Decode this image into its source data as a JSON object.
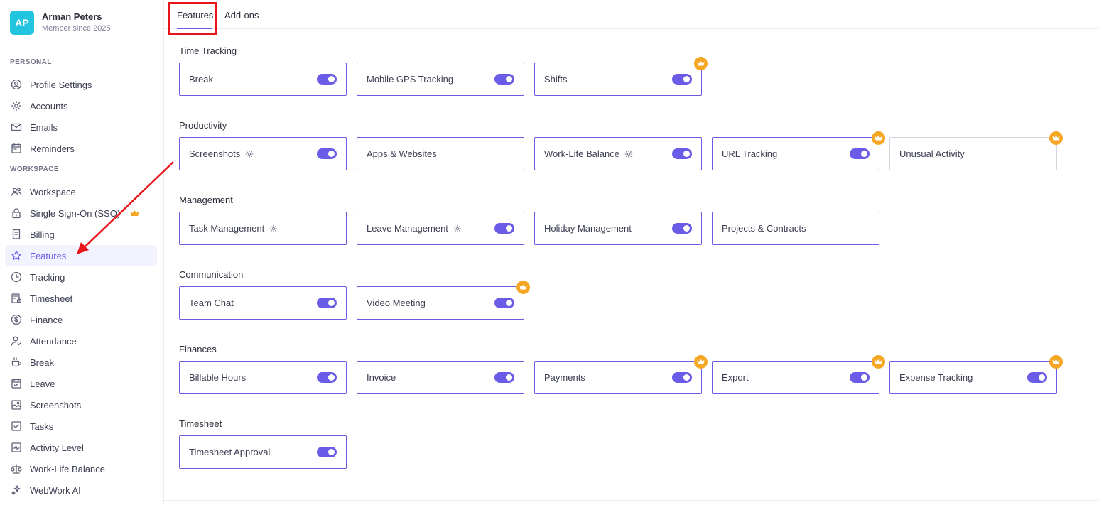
{
  "profile": {
    "initials": "AP",
    "name": "Arman Peters",
    "subtitle": "Member since 2025"
  },
  "sidebar": {
    "personal_label": "PERSONAL",
    "workspace_label": "WORKSPACE",
    "personal_items": [
      {
        "label": "Profile Settings",
        "icon": "user-circle-icon"
      },
      {
        "label": "Accounts",
        "icon": "gear-icon"
      },
      {
        "label": "Emails",
        "icon": "mail-icon"
      },
      {
        "label": "Reminders",
        "icon": "calendar-icon"
      }
    ],
    "workspace_items": [
      {
        "label": "Workspace",
        "icon": "users-icon"
      },
      {
        "label": "Single Sign-On (SSO)",
        "icon": "lock-icon"
      },
      {
        "label": "Billing",
        "icon": "receipt-icon"
      },
      {
        "label": "Features",
        "icon": "star-icon"
      },
      {
        "label": "Tracking",
        "icon": "clock-icon"
      },
      {
        "label": "Timesheet",
        "icon": "timesheet-icon"
      },
      {
        "label": "Finance",
        "icon": "dollar-icon"
      },
      {
        "label": "Attendance",
        "icon": "user-check-icon"
      },
      {
        "label": "Break",
        "icon": "cup-icon"
      },
      {
        "label": "Leave",
        "icon": "calendar-check-icon"
      },
      {
        "label": "Screenshots",
        "icon": "image-icon"
      },
      {
        "label": "Tasks",
        "icon": "task-icon"
      },
      {
        "label": "Activity Level",
        "icon": "activity-icon"
      },
      {
        "label": "Work-Life Balance",
        "icon": "scale-icon"
      },
      {
        "label": "WebWork AI",
        "icon": "sparkle-icon"
      }
    ],
    "active_item": "Features"
  },
  "tabs": [
    {
      "label": "Features"
    },
    {
      "label": "Add-ons"
    }
  ],
  "groups": [
    {
      "title": "Time Tracking",
      "cards": [
        {
          "label": "Break",
          "toggle": true,
          "premium": false,
          "gear": false
        },
        {
          "label": "Mobile GPS Tracking",
          "toggle": true,
          "premium": false,
          "gear": false
        },
        {
          "label": "Shifts",
          "toggle": true,
          "premium": true,
          "gear": false
        }
      ]
    },
    {
      "title": "Productivity",
      "cards": [
        {
          "label": "Screenshots",
          "toggle": true,
          "premium": false,
          "gear": true
        },
        {
          "label": "Apps & Websites",
          "toggle": false,
          "premium": false,
          "gear": false
        },
        {
          "label": "Work-Life Balance",
          "toggle": true,
          "premium": false,
          "gear": true
        },
        {
          "label": "URL Tracking",
          "toggle": true,
          "premium": true,
          "gear": false
        },
        {
          "label": "Unusual Activity",
          "toggle": false,
          "premium": true,
          "gear": false,
          "muted": true
        }
      ]
    },
    {
      "title": "Management",
      "cards": [
        {
          "label": "Task Management",
          "toggle": false,
          "premium": false,
          "gear": true
        },
        {
          "label": "Leave Management",
          "toggle": true,
          "premium": false,
          "gear": true
        },
        {
          "label": "Holiday Management",
          "toggle": true,
          "premium": false,
          "gear": false
        },
        {
          "label": "Projects & Contracts",
          "toggle": false,
          "premium": false,
          "gear": false
        }
      ]
    },
    {
      "title": "Communication",
      "cards": [
        {
          "label": "Team Chat",
          "toggle": true,
          "premium": false,
          "gear": false
        },
        {
          "label": "Video Meeting",
          "toggle": true,
          "premium": true,
          "gear": false
        }
      ]
    },
    {
      "title": "Finances",
      "cards": [
        {
          "label": "Billable Hours",
          "toggle": true,
          "premium": false,
          "gear": false
        },
        {
          "label": "Invoice",
          "toggle": true,
          "premium": false,
          "gear": false
        },
        {
          "label": "Payments",
          "toggle": true,
          "premium": true,
          "gear": false
        },
        {
          "label": "Export",
          "toggle": true,
          "premium": true,
          "gear": false
        },
        {
          "label": "Expense Tracking",
          "toggle": true,
          "premium": true,
          "gear": false
        }
      ]
    },
    {
      "title": "Timesheet",
      "cards": [
        {
          "label": "Timesheet Approval",
          "toggle": true,
          "premium": false,
          "gear": false
        }
      ]
    }
  ],
  "colors": {
    "accent": "#6b5ce7",
    "premium": "#f5a623",
    "avatar": "#22c5e0",
    "annotation": "#e8141a"
  }
}
